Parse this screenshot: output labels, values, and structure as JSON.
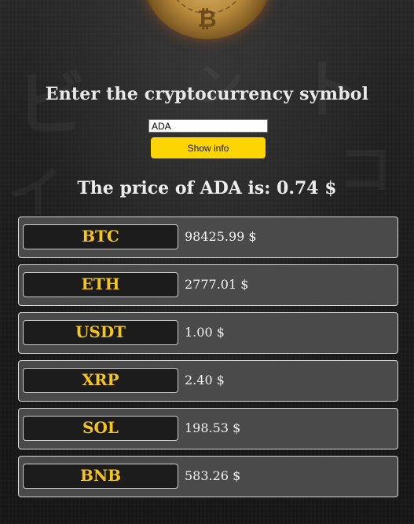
{
  "logo": {
    "icon": "bitcoin-coin-icon",
    "symbol": "₿"
  },
  "header": {
    "title": "Enter the cryptocurrency symbol"
  },
  "form": {
    "symbol_value": "ADA",
    "show_info_label": "Show info"
  },
  "result": {
    "text": "The price of ADA is: 0.74 $"
  },
  "coins": [
    {
      "symbol": "BTC",
      "price": "98425.99 $"
    },
    {
      "symbol": "ETH",
      "price": "2777.01 $"
    },
    {
      "symbol": "USDT",
      "price": "1.00 $"
    },
    {
      "symbol": "XRP",
      "price": "2.40 $"
    },
    {
      "symbol": "SOL",
      "price": "198.53 $"
    },
    {
      "symbol": "BNB",
      "price": "583.26 $"
    }
  ],
  "colors": {
    "accent": "#ffd500",
    "badge_text": "#f5c518",
    "row_background": "#4a4a4a",
    "badge_background": "#1c1c1c"
  }
}
